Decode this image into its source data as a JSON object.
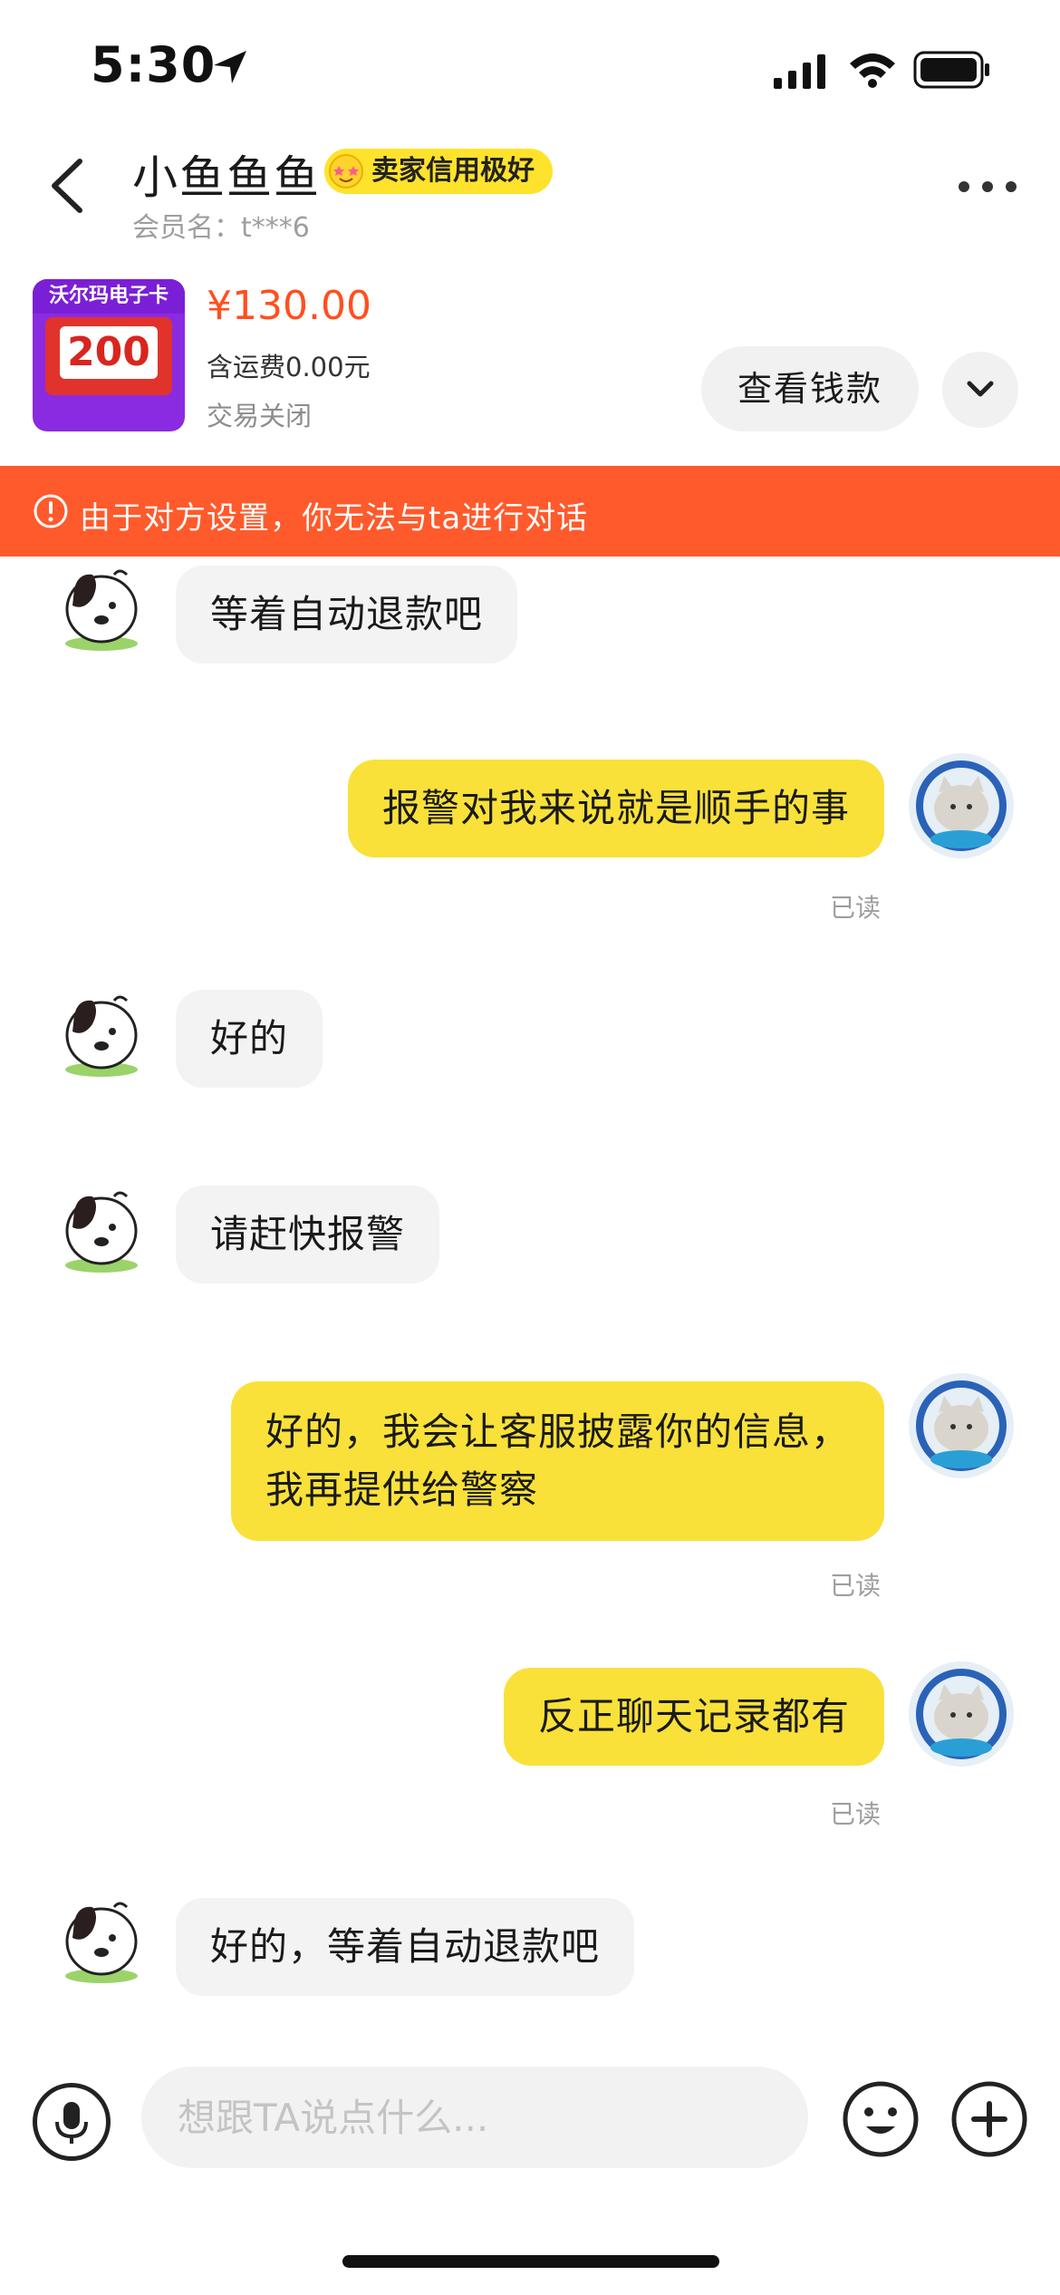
{
  "status_bar": {
    "time": "5:30"
  },
  "header": {
    "nickname": "小鱼鱼鱼",
    "badge": "卖家信用极好",
    "member_label": "会员名：t***6"
  },
  "product": {
    "thumb_title": "沃尔玛电子卡",
    "thumb_amount": "200",
    "price": "¥130.00",
    "shipping": "含运费0.00元",
    "status": "交易关闭",
    "view_button": "查看钱款"
  },
  "warning": {
    "text": "由于对方设置，你无法与ta进行对话"
  },
  "messages": [
    {
      "side": "left",
      "text": "等着自动退款吧"
    },
    {
      "side": "right",
      "text": "报警对我来说就是顺手的事",
      "read": "已读"
    },
    {
      "side": "left",
      "text": "好的"
    },
    {
      "side": "left",
      "text": "请赶快报警"
    },
    {
      "side": "right",
      "line1": "好的，我会让客服披露你的信息，",
      "line2": "我再提供给警察",
      "read": "已读"
    },
    {
      "side": "right",
      "text": "反正聊天记录都有",
      "read": "已读"
    },
    {
      "side": "left",
      "text": "好的，等着自动退款吧"
    }
  ],
  "input": {
    "placeholder": "想跟TA说点什么..."
  },
  "colors": {
    "accent": "#ff5a2c",
    "price": "#ff4f1f",
    "bubble_right": "#f9e13a",
    "badge": "#ffe22b"
  }
}
